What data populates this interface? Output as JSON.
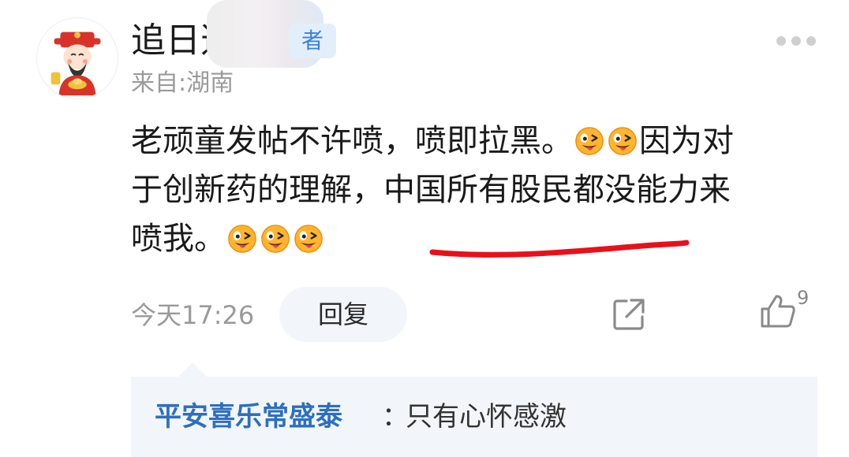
{
  "comment": {
    "username": "追日逍",
    "role_badge": "者",
    "location": "来自:湖南",
    "text_line1": "老顽童发帖不许喷，喷即拉黑。",
    "text_line1b": "因为对",
    "text_line2": "于创新药的理解，中国所有股民都没能力来",
    "text_line3": "喷我。",
    "emoji_name": "wink-tongue-emoji",
    "timestamp": "今天17:26",
    "reply_label": "回复",
    "like_count": "9"
  },
  "reply_preview": {
    "author": "平安喜乐常盛泰",
    "separator": "：",
    "text": "只有心怀感激"
  },
  "colors": {
    "underline": "#e8101a",
    "author_link": "#2d6fbf",
    "badge_text": "#3a83d8",
    "muted_text": "#9a9a9a",
    "reply_bg": "#f2f6fa"
  }
}
